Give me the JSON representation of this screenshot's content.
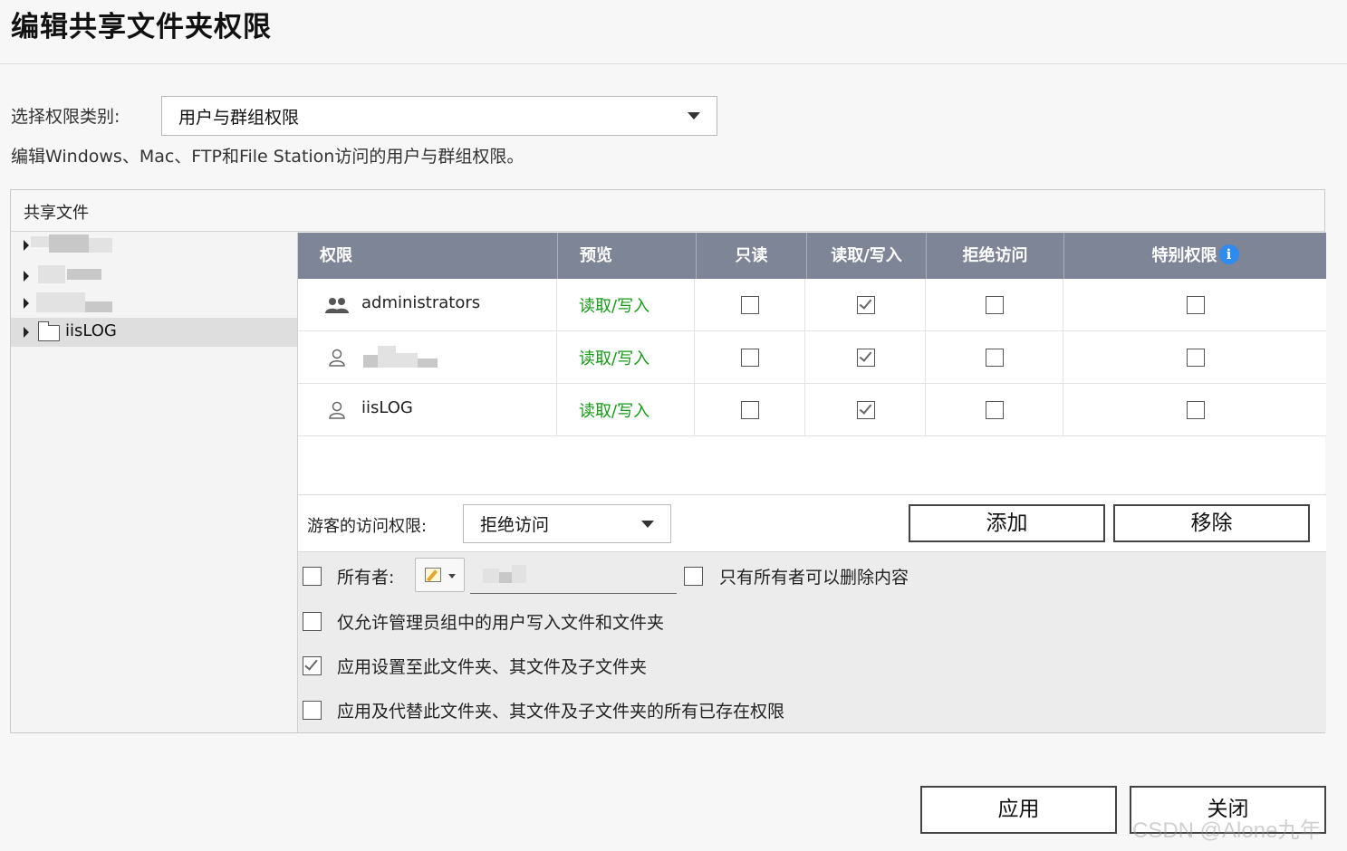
{
  "dialog": {
    "title": "编辑共享文件夹权限",
    "category_label": "选择权限类别:",
    "category_value": "用户与群组权限",
    "description": "编辑Windows、Mac、FTP和File Station访问的用户与群组权限。"
  },
  "shared_panel": {
    "header": "共享文件",
    "tree": [
      {
        "label": "",
        "selected": false
      },
      {
        "label": "",
        "selected": false
      },
      {
        "label": "",
        "selected": false
      },
      {
        "label": "iisLOG",
        "selected": true
      }
    ]
  },
  "table": {
    "headers": [
      "权限",
      "预览",
      "只读",
      "读取/写入",
      "拒绝访问",
      "特别权限"
    ],
    "info_icon_glyph": "i",
    "rows": [
      {
        "icon": "group-icon",
        "name": "administrators",
        "preview": "读取/写入",
        "read_only": false,
        "read_write": true,
        "deny": false,
        "special": false
      },
      {
        "icon": "user-icon",
        "name": "",
        "preview": "读取/写入",
        "read_only": false,
        "read_write": true,
        "deny": false,
        "special": false
      },
      {
        "icon": "user-icon",
        "name": "iisLOG",
        "preview": "读取/写入",
        "read_only": false,
        "read_write": true,
        "deny": false,
        "special": false
      }
    ]
  },
  "guest": {
    "label": "游客的访问权限:",
    "value": "拒绝访问"
  },
  "actions": {
    "add": "添加",
    "remove": "移除",
    "apply": "应用",
    "close": "关闭"
  },
  "options": {
    "owner_label": "所有者:",
    "owner_checked": false,
    "only_owner_delete": "只有所有者可以删除内容",
    "only_owner_delete_checked": false,
    "admin_only_write": "仅允许管理员组中的用户写入文件和文件夹",
    "admin_only_write_checked": false,
    "apply_to_subfolders": "应用设置至此文件夹、其文件及子文件夹",
    "apply_to_subfolders_checked": true,
    "replace_existing": "应用及代替此文件夹、其文件及子文件夹的所有已存在权限",
    "replace_existing_checked": false
  },
  "watermark": "CSDN @Alone九年",
  "colors": {
    "header_bg": "#7d8596",
    "preview_green": "#159a15",
    "info_blue": "#2e8bf0"
  }
}
